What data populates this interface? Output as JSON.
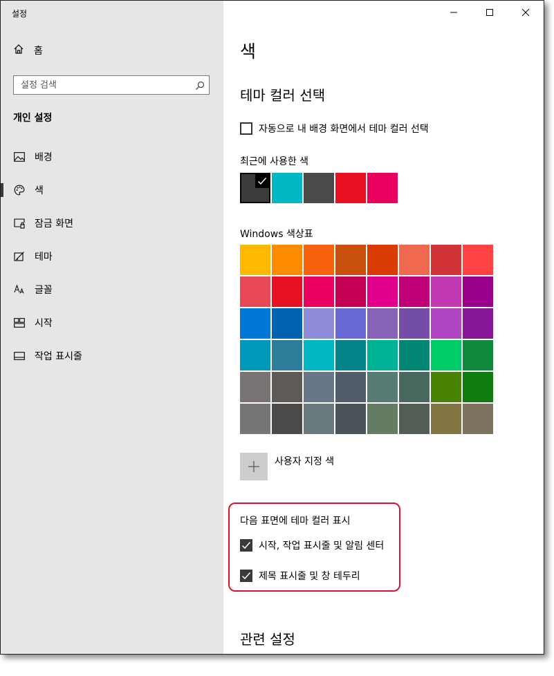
{
  "window": {
    "title": "설정",
    "controls": {
      "minimize": "minimize-icon",
      "maximize": "maximize-icon",
      "close": "close-icon"
    }
  },
  "sidebar": {
    "home_label": "홈",
    "search": {
      "placeholder": "설정 검색"
    },
    "section_title": "개인 설정",
    "items": [
      {
        "label": "배경",
        "icon": "picture-icon",
        "active": false
      },
      {
        "label": "색",
        "icon": "palette-icon",
        "active": true
      },
      {
        "label": "잠금 화면",
        "icon": "lock-screen-icon",
        "active": false
      },
      {
        "label": "테마",
        "icon": "theme-icon",
        "active": false
      },
      {
        "label": "글꼴",
        "icon": "font-icon",
        "active": false
      },
      {
        "label": "시작",
        "icon": "start-icon",
        "active": false
      },
      {
        "label": "작업 표시줄",
        "icon": "taskbar-icon",
        "active": false
      }
    ]
  },
  "main": {
    "page_title": "색",
    "accent_heading": "테마 컬러 선택",
    "auto_pick_label": "자동으로 내 배경 화면에서 테마 컬러 선택",
    "auto_pick_checked": false,
    "recent_label": "최근에 사용한 색",
    "recent_colors": [
      "#3c3c3c",
      "#00b7c3",
      "#4c4a48",
      "#e81123",
      "#ea005e"
    ],
    "palette_label": "Windows 색상표",
    "palette_colors": [
      "#ffb900",
      "#ff8c00",
      "#f7630c",
      "#ca5010",
      "#da3b01",
      "#ef6950",
      "#d13438",
      "#ff4343",
      "#e74856",
      "#e81123",
      "#ea005e",
      "#c30052",
      "#e3008c",
      "#bf0077",
      "#c239b3",
      "#9a0089",
      "#0078d7",
      "#0063b1",
      "#8e8cd8",
      "#6b69d6",
      "#8764b8",
      "#744da9",
      "#b146c2",
      "#881798",
      "#0099bc",
      "#2d7d9a",
      "#00b7c3",
      "#038387",
      "#00b294",
      "#018574",
      "#00cc6a",
      "#10893e",
      "#7a7574",
      "#5d5a58",
      "#68768a",
      "#515c6b",
      "#567c73",
      "#486860",
      "#498205",
      "#107c10",
      "#767676",
      "#4c4a48",
      "#69797e",
      "#4a5459",
      "#647c64",
      "#525e54",
      "#847545",
      "#7e735f"
    ],
    "custom_color_label": "사용자 지정 색",
    "surfaces_heading": "다음 표면에 테마 컬러 표시",
    "surface_options": [
      {
        "label": "시작, 작업 표시줄 및 알림 센터",
        "checked": true
      },
      {
        "label": "제목 표시줄 및 창 테두리",
        "checked": true
      }
    ],
    "related_heading": "관련 설정"
  }
}
